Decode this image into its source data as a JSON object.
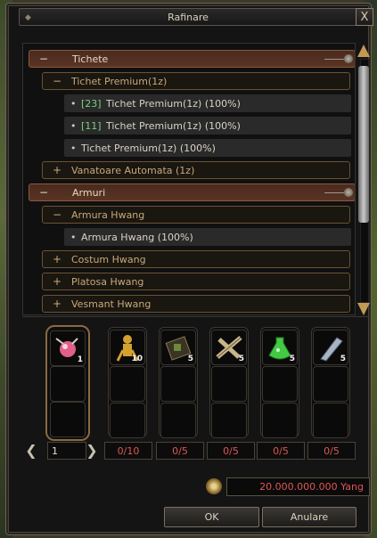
{
  "window": {
    "title": "Rafinare",
    "close_label": "X"
  },
  "tree": [
    {
      "kind": "category",
      "symbol": "−",
      "label": "Tichete"
    },
    {
      "kind": "subcategory",
      "symbol": "−",
      "label": "Tichet Premium(1z)"
    },
    {
      "kind": "item",
      "count": "[23]",
      "label": "Tichet Premium(1z) (100%)"
    },
    {
      "kind": "item",
      "count": "[11]",
      "label": "Tichet Premium(1z) (100%)"
    },
    {
      "kind": "item",
      "count": "",
      "label": "Tichet Premium(1z) (100%)"
    },
    {
      "kind": "subcategory",
      "symbol": "+",
      "label": "Vanatoare Automata (1z)"
    },
    {
      "kind": "category",
      "symbol": "−",
      "label": "Armuri"
    },
    {
      "kind": "subcategory",
      "symbol": "−",
      "label": "Armura Hwang"
    },
    {
      "kind": "item",
      "count": "",
      "label": "Armura Hwang (100%)"
    },
    {
      "kind": "subcategory",
      "symbol": "+",
      "label": "Costum Hwang"
    },
    {
      "kind": "subcategory",
      "symbol": "+",
      "label": "Platosa Hwang"
    },
    {
      "kind": "subcategory",
      "symbol": "+",
      "label": "Vesmant Hwang"
    }
  ],
  "main_item": {
    "icon": "pink-orb-item-icon",
    "qty": "1"
  },
  "materials": [
    {
      "icon": "golden-figurine-icon",
      "qty": "10",
      "counter": "0/10",
      "color": "#d4a030"
    },
    {
      "icon": "scroll-bundle-icon",
      "qty": "5",
      "counter": "0/5",
      "color": "#8a7a50"
    },
    {
      "icon": "crossed-bones-icon",
      "qty": "5",
      "counter": "0/5",
      "color": "#c9b58a"
    },
    {
      "icon": "green-potion-icon",
      "qty": "5",
      "counter": "0/5",
      "color": "#45c945"
    },
    {
      "icon": "silver-shard-icon",
      "qty": "5",
      "counter": "0/5",
      "color": "#a8b4c4"
    }
  ],
  "pager": {
    "prev": "❮",
    "value": "1",
    "next": "❯"
  },
  "yang": {
    "amount": "20.000.000.000 Yang"
  },
  "buttons": {
    "ok": "OK",
    "cancel": "Anulare"
  },
  "scrollbar": {
    "position": 0.0
  }
}
